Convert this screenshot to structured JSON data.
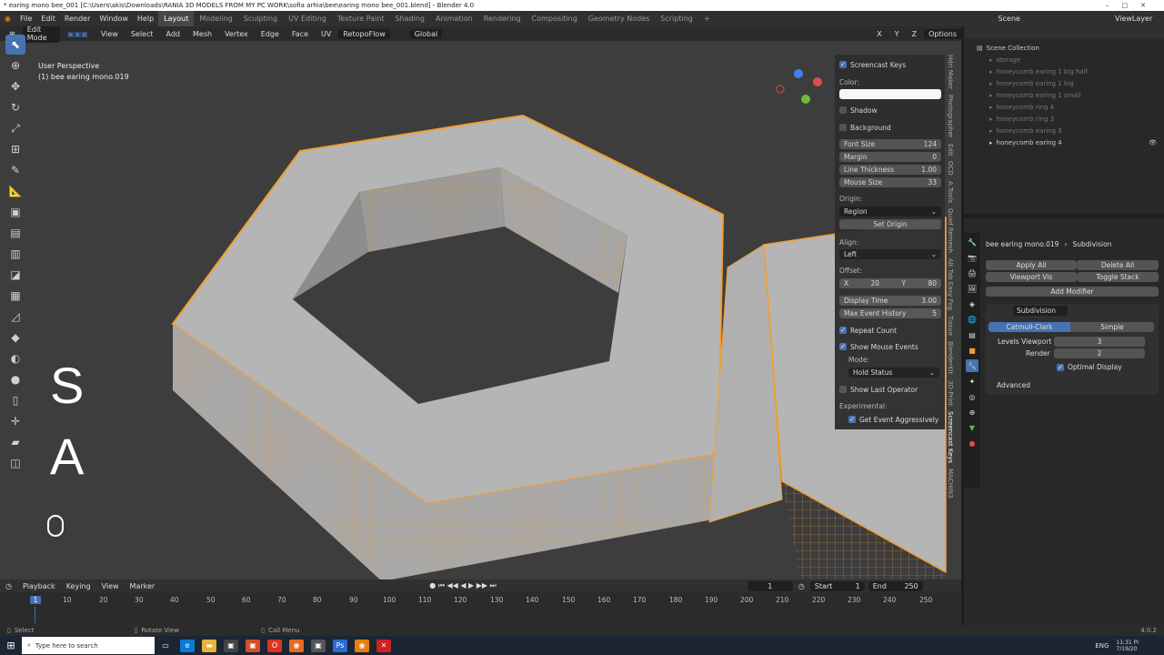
{
  "window": {
    "title": "* earing mono bee_001 [C:\\Users\\akis\\Downloads\\RANIA 3D MODELS FROM MY PC WORK\\sofia arhia\\bee\\earing mono bee_001.blend] - Blender 4.0"
  },
  "menu": [
    "File",
    "Edit",
    "Render",
    "Window",
    "Help"
  ],
  "workspaces": [
    "Layout",
    "Modeling",
    "Sculpting",
    "UV Editing",
    "Texture Paint",
    "Shading",
    "Animation",
    "Rendering",
    "Compositing",
    "Geometry Nodes",
    "Scripting"
  ],
  "active_workspace": "Layout",
  "scene": {
    "scene_label": "Scene",
    "viewlayer_label": "ViewLayer"
  },
  "viewport_header": {
    "mode": "Edit Mode",
    "menus": [
      "View",
      "Select",
      "Add",
      "Mesh",
      "Vertex",
      "Edge",
      "Face",
      "UV"
    ],
    "retopoflow": "RetopoFlow",
    "orientation": "Global",
    "options": "Options",
    "axes": [
      "X",
      "Y",
      "Z"
    ]
  },
  "viewport": {
    "perspective": "User Perspective",
    "object": "(1) bee earing mono.019",
    "key_big_1": "S",
    "key_big_2": "A"
  },
  "screencast_keys": {
    "title": "Screencast Keys",
    "color_label": "Color:",
    "shadow": "Shadow",
    "background": "Background",
    "font_size_label": "Font Size",
    "font_size": "124",
    "margin_label": "Margin",
    "margin": "0",
    "line_thickness_label": "Line Thickness",
    "line_thickness": "1.00",
    "mouse_size_label": "Mouse Size",
    "mouse_size": "33",
    "origin_label": "Origin:",
    "origin": "Region",
    "set_origin": "Set Origin",
    "align_label": "Align:",
    "align": "Left",
    "offset_label": "Offset:",
    "offset_x_label": "X",
    "offset_x": "20",
    "offset_y_label": "Y",
    "offset_y": "80",
    "display_time_label": "Display Time",
    "display_time": "3.00",
    "max_event_label": "Max Event History",
    "max_event": "5",
    "repeat_count": "Repeat Count",
    "show_mouse_events": "Show Mouse Events",
    "mode_label": "Mode:",
    "mode": "Hold Status",
    "show_last_operator": "Show Last Operator",
    "experimental_label": "Experimental:",
    "get_event_aggressively": "Get Event Aggressively"
  },
  "sidebar_tabs": [
    "Hdri Maker",
    "Photographer",
    "Edit",
    "OCD",
    "A.Tools",
    "Quad Remesh",
    "Alt Tab Easy Fog",
    "Tissue",
    "BlenderKit",
    "3D-Print",
    "Screencast Keys",
    "MACHIN3"
  ],
  "outliner": {
    "title": "Scene Collection",
    "items": [
      {
        "name": "storage",
        "dim": true
      },
      {
        "name": "honeycomb earing 1 big half",
        "dim": true
      },
      {
        "name": "honeycomb earing 1 big",
        "dim": true
      },
      {
        "name": "honeycomb earing 1 small",
        "dim": true
      },
      {
        "name": "honeycomb ring 4",
        "dim": true
      },
      {
        "name": "honeycomb ring 3",
        "dim": true
      },
      {
        "name": "honeycomb earing 3",
        "dim": true
      },
      {
        "name": "honeycomb earing 4",
        "dim": false
      }
    ]
  },
  "properties": {
    "object_name": "bee earing mono.019",
    "modifier_crumb": "Subdivision",
    "apply_all": "Apply All",
    "delete_all": "Delete All",
    "viewport_vis": "Viewport Vis",
    "toggle_stack": "Toggle Stack",
    "add_modifier": "Add Modifier",
    "modifier_name": "Subdivision",
    "catmull": "Catmull-Clark",
    "simple": "Simple",
    "levels_viewport_label": "Levels Viewport",
    "levels_viewport": "3",
    "render_label": "Render",
    "render": "2",
    "optimal_display": "Optimal Display",
    "advanced": "Advanced"
  },
  "timeline": {
    "menus": [
      "Playback",
      "Keying",
      "View",
      "Marker"
    ],
    "current_frame": "1",
    "start_label": "Start",
    "start": "1",
    "end_label": "End",
    "end": "250",
    "ticks": [
      "1",
      "10",
      "20",
      "30",
      "40",
      "50",
      "60",
      "70",
      "80",
      "90",
      "100",
      "110",
      "120",
      "130",
      "140",
      "150",
      "160",
      "170",
      "180",
      "190",
      "200",
      "210",
      "220",
      "230",
      "240",
      "250"
    ]
  },
  "status": {
    "select": "Select",
    "rotate": "Rotate View",
    "call": "Call Menu",
    "version": "4.0.2"
  },
  "taskbar": {
    "search": "Type here to search",
    "lang": "ENG",
    "time": "11:31 PI",
    "date": "7/19/20"
  },
  "colors": {
    "accent": "#4772b3",
    "orange": "#f0a030",
    "mesh": "#b8b8b8"
  }
}
